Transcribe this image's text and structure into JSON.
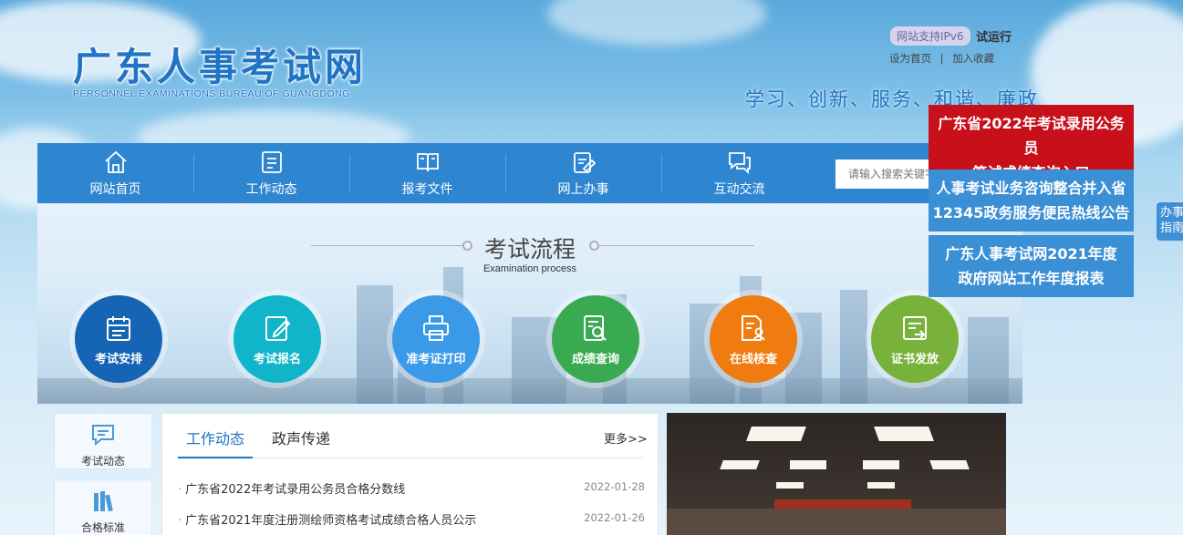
{
  "header": {
    "logo_cn": "广东人事考试网",
    "logo_en": "PERSONNEL EXAMINATIONS BUREAU OF GUANGDONG",
    "ipv6_badge": "网站支持IPv6",
    "trial": "试运行",
    "set_home": "设为首页",
    "separator": "|",
    "add_favorite": "加入收藏",
    "slogan": "学习、创新、服务、和谐、廉政"
  },
  "nav": {
    "items": [
      {
        "label": "网站首页",
        "icon": "home-icon"
      },
      {
        "label": "工作动态",
        "icon": "list-icon"
      },
      {
        "label": "报考文件",
        "icon": "book-icon"
      },
      {
        "label": "网上办事",
        "icon": "clipboard-edit-icon"
      },
      {
        "label": "互动交流",
        "icon": "chat-icon"
      }
    ],
    "search_placeholder": "请输入搜索关键字"
  },
  "process": {
    "title": "考试流程",
    "subtitle": "Examination process",
    "steps": [
      {
        "label": "考试安排",
        "icon": "calendar-icon",
        "color": "#1565b4"
      },
      {
        "label": "考试报名",
        "icon": "pen-icon",
        "color": "#10b5c9"
      },
      {
        "label": "准考证打印",
        "icon": "printer-icon",
        "color": "#3a9ae8"
      },
      {
        "label": "成绩查询",
        "icon": "search-doc-icon",
        "color": "#3aaa52"
      },
      {
        "label": "在线核查",
        "icon": "user-doc-icon",
        "color": "#f07b0f"
      },
      {
        "label": "证书发放",
        "icon": "certificate-icon",
        "color": "#79b23a"
      }
    ]
  },
  "side": {
    "items": [
      {
        "label": "考试动态",
        "icon": "message-icon"
      },
      {
        "label": "合格标准",
        "icon": "books-icon"
      }
    ]
  },
  "news": {
    "tabs": [
      "工作动态",
      "政声传递"
    ],
    "more": "更多>>",
    "items": [
      {
        "title": "广东省2022年考试录用公务员合格分数线",
        "date": "2022-01-28"
      },
      {
        "title": "广东省2021年度注册测绘师资格考试成绩合格人员公示",
        "date": "2022-01-26"
      }
    ]
  },
  "notices": [
    {
      "line1": "广东省2022年考试录用公务员",
      "line2": "笔试成绩查询入口",
      "color": "#c8101a"
    },
    {
      "line1": "人事考试业务咨询整合并入省",
      "line2": "12345政务服务便民热线公告",
      "color": "#3b8fd4"
    },
    {
      "line1": "广东人事考试网2021年度",
      "line2": "政府网站工作年度报表",
      "color": "#3b8fd4"
    }
  ],
  "float_tab": {
    "line1": "办事",
    "line2": "指南"
  }
}
